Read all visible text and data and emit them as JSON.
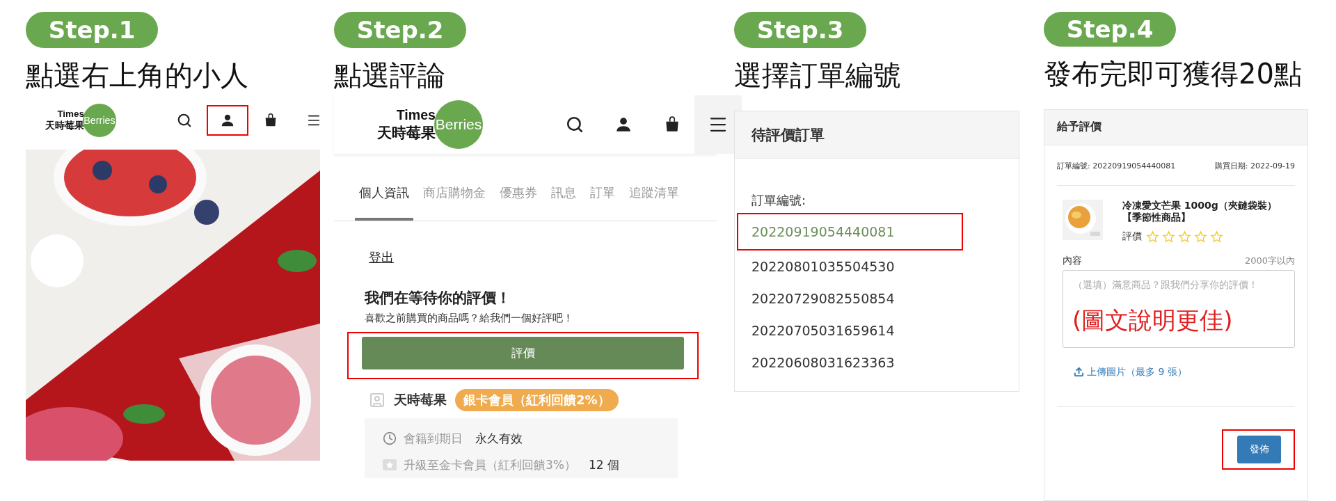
{
  "steps": [
    {
      "kind": "home",
      "badge": "Step.1",
      "title": "點選右上角的小人",
      "screen": {
        "logo": {
          "word": "Times",
          "mark": "Berries",
          "name": "天時莓果"
        },
        "icons": [
          {
            "kind": "search",
            "highlighted": false
          },
          {
            "kind": "user",
            "highlighted": true
          },
          {
            "kind": "bag",
            "highlighted": false
          },
          {
            "kind": "menu",
            "highlighted": false
          }
        ]
      }
    },
    {
      "kind": "account",
      "badge": "Step.2",
      "title": "點選評論",
      "screen": {
        "logo": {
          "word": "Times",
          "mark": "Berries",
          "name": "天時莓果"
        },
        "icons": [
          {
            "kind": "search",
            "highlighted": false
          },
          {
            "kind": "user",
            "highlighted": false
          },
          {
            "kind": "bag",
            "highlighted": false
          },
          {
            "kind": "menu",
            "highlighted": false
          }
        ],
        "tabs": [
          {
            "label": "個人資訊",
            "selected": true
          },
          {
            "label": "商店購物金",
            "selected": false
          },
          {
            "label": "優惠券",
            "selected": false
          },
          {
            "label": "訊息",
            "selected": false
          },
          {
            "label": "訂單",
            "selected": false
          },
          {
            "label": "追蹤清單",
            "selected": false
          }
        ],
        "logout": "登出",
        "heading": "我們在等待你的評價！",
        "subtitle": "喜歡之前購買的商品嗎？給我們一個好評吧！",
        "review_button": {
          "label": "評價",
          "highlighted": true
        },
        "member": {
          "name": "天時莓果",
          "tier": "銀卡會員（紅利回饋2%）"
        },
        "info_rows": [
          {
            "kind": "clock",
            "label": "會籍到期日",
            "value": "永久有效"
          },
          {
            "kind": "upgrade",
            "label": "升級至金卡會員（紅利回饋3%）",
            "value": "12 個"
          }
        ]
      }
    },
    {
      "kind": "orders",
      "badge": "Step.3",
      "title": "選擇訂單編號",
      "screen": {
        "header": "待評價訂單",
        "label": "訂單編號:",
        "orders": [
          {
            "number": "20220919054440081",
            "selected": true
          },
          {
            "number": "20220801035504530",
            "selected": false
          },
          {
            "number": "20220729082550854",
            "selected": false
          },
          {
            "number": "20220705031659614",
            "selected": false
          },
          {
            "number": "20220608031623363",
            "selected": false
          }
        ]
      }
    },
    {
      "kind": "review",
      "badge": "Step.4",
      "title": "發布完即可獲得20點",
      "screen": {
        "header": "給予評價",
        "order_no": "訂單編號: 20220919054440081",
        "purchase_date": "購買日期: 2022-09-19",
        "product": {
          "name": "冷凍愛文芒果 1000g（夾鏈袋裝）【季節性商品】"
        },
        "rating": {
          "label": "評價",
          "stars": 0
        },
        "content": {
          "label": "內容",
          "limit": "2000字以內",
          "placeholder": "（選填）滿意商品？跟我們分享你的評價！",
          "annotation": "(圖文說明更佳)"
        },
        "upload": "上傳圖片（最多 9 張）",
        "publish_button": {
          "label": "發佈",
          "highlighted": true
        }
      }
    }
  ]
}
